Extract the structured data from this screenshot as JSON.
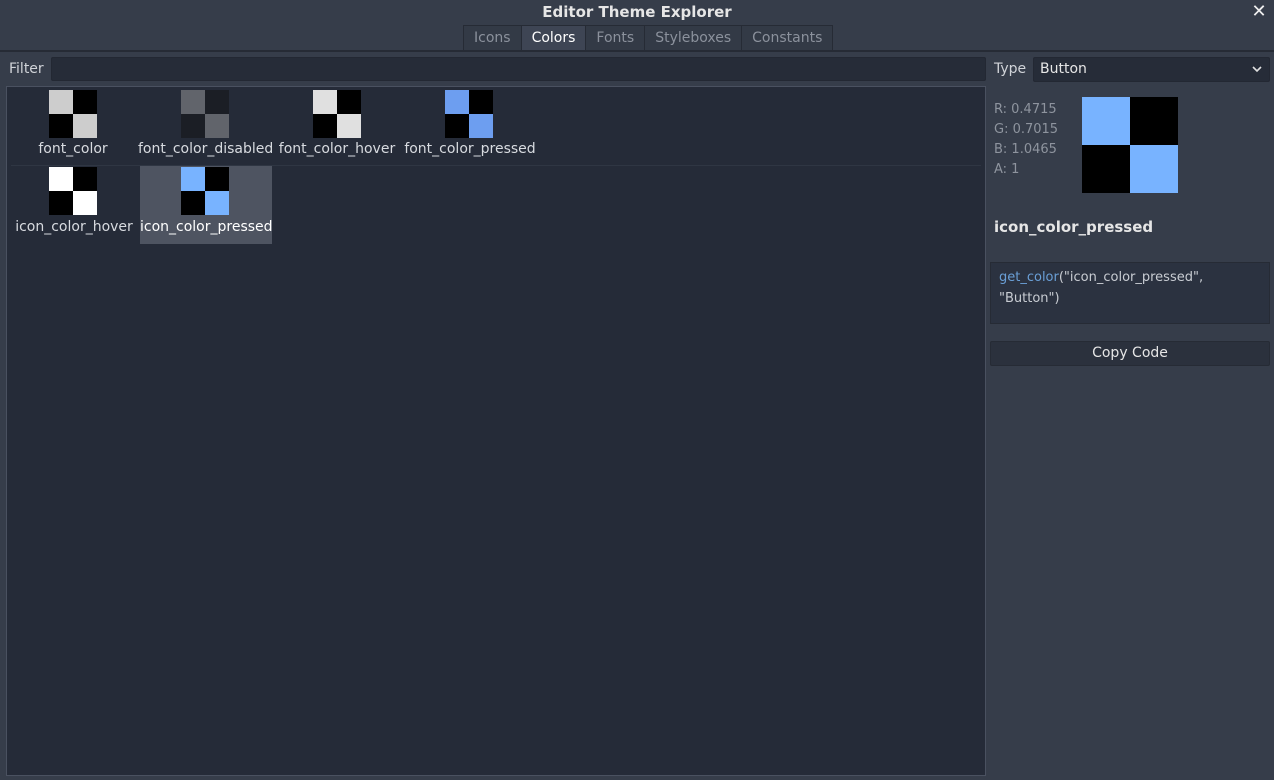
{
  "window": {
    "title": "Editor Theme Explorer",
    "close_glyph": "✕"
  },
  "tabs": [
    {
      "label": "Icons",
      "active": false
    },
    {
      "label": "Colors",
      "active": true
    },
    {
      "label": "Fonts",
      "active": false
    },
    {
      "label": "Styleboxes",
      "active": false
    },
    {
      "label": "Constants",
      "active": false
    }
  ],
  "filter": {
    "label": "Filter",
    "value": "",
    "placeholder": ""
  },
  "colors": [
    {
      "name": "font_color",
      "swatch": "#cdcdcd",
      "selected": false
    },
    {
      "name": "font_color_disabled",
      "swatch": "#61646b",
      "selected": false
    },
    {
      "name": "font_color_hover",
      "swatch": "#e0e0e0",
      "selected": false
    },
    {
      "name": "font_color_pressed",
      "swatch": "#6d9ef0",
      "selected": false
    },
    {
      "name": "icon_color_hover",
      "swatch": "#ffffff",
      "selected": false
    },
    {
      "name": "icon_color_pressed",
      "swatch": "#78b3ff",
      "selected": true
    }
  ],
  "type": {
    "label": "Type",
    "value": "Button",
    "chevron_icon": "chevron-down-icon"
  },
  "details": {
    "r": "R: 0.4715",
    "g": "G: 0.7015",
    "b": "B: 1.0465",
    "a": "A: 1",
    "swatch": "#78b3ff",
    "name": "icon_color_pressed",
    "code_fn": "get_color",
    "code_line1_rest": "(\"icon_color_pressed\",",
    "code_line2": "\"Button\")",
    "copy_label": "Copy Code"
  }
}
